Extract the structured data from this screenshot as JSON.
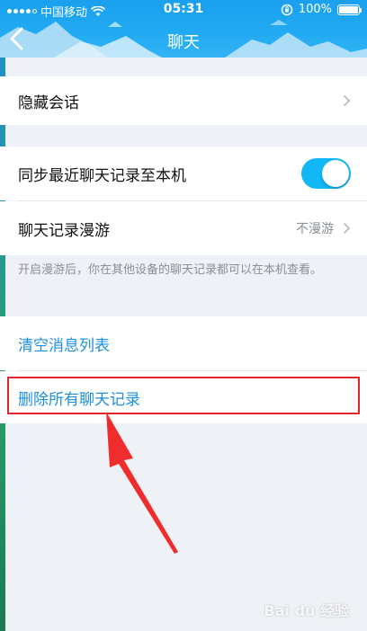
{
  "status_bar": {
    "carrier": "中国移动",
    "time": "05:31",
    "battery": "100%"
  },
  "nav": {
    "title": "聊天",
    "back_icon": "chevron-left-icon"
  },
  "settings": {
    "hide_session": {
      "label": "隐藏会话"
    },
    "sync_recent": {
      "label": "同步最近聊天记录至本机",
      "enabled": true
    },
    "roaming": {
      "label": "聊天记录漫游",
      "value": "不漫游"
    },
    "roaming_note": "开启漫游后，你在其他设备的聊天记录都可以在本机查看。",
    "clear_list": {
      "label": "清空消息列表"
    },
    "delete_all": {
      "label": "删除所有聊天记录"
    }
  },
  "colors": {
    "header": "#1aa0ee",
    "toggle_on": "#12b7f5",
    "link_blue": "#1c8fe0",
    "highlight": "#e0262a"
  },
  "watermark": "Bai du 经验"
}
